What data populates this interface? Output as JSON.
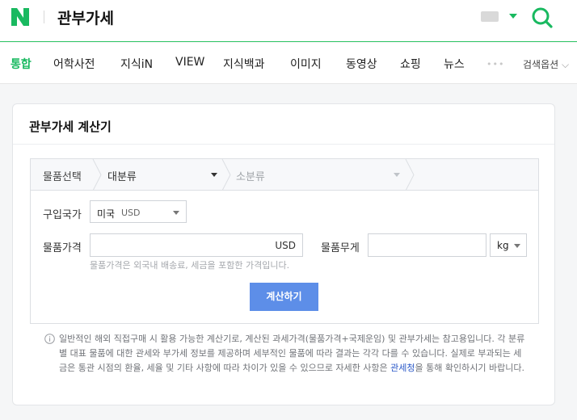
{
  "header": {
    "logo_letter": "N",
    "query": "관부가세",
    "colors": {
      "brand": "#19b960",
      "brand_line": "#2fc465"
    }
  },
  "tabs": [
    {
      "label": "통합",
      "active": true
    },
    {
      "label": "어학사전",
      "active": false
    },
    {
      "label": "지식iN",
      "active": false
    },
    {
      "label": "VIEW",
      "active": false
    },
    {
      "label": "지식백과",
      "active": false
    },
    {
      "label": "이미지",
      "active": false
    },
    {
      "label": "동영상",
      "active": false
    },
    {
      "label": "쇼핑",
      "active": false
    },
    {
      "label": "뉴스",
      "active": false
    }
  ],
  "tab_more": "•••",
  "tab_options": "검색옵션",
  "card": {
    "title": "관부가세 계산기",
    "crumb": {
      "step1": "물품선택",
      "step2": "대분류",
      "step3": "소분류"
    },
    "country": {
      "label": "구입국가",
      "value": "미국",
      "currency": "USD"
    },
    "price": {
      "label": "물품가격",
      "value": "",
      "unit": "USD",
      "helper": "물품가격은 외국내 배송료, 세금을 포함한 가격입니다."
    },
    "weight": {
      "label": "물품무게",
      "value": "",
      "unit": "kg"
    },
    "calc_button": "계산하기",
    "notice": {
      "text_before": "일반적인 해외 직접구매 시 활용 가능한 계산기로, 계산된 과세가격(물품가격+국제운임) 및 관부가세는 참고용입니다. 각 분류별 대표 물품에 대한 관세와 부가세 정보를 제공하며 세부적인 물품에 따라 결과는 각각 다를 수 있습니다. 실제로 부과되는 세금은 통관 시점의 환율, 세율 및 기타 사항에 따라 차이가 있을 수 있으므로 자세한 사항은 ",
      "link": "관세청",
      "text_after": "을 통해 확인하시기 바랍니다."
    }
  }
}
